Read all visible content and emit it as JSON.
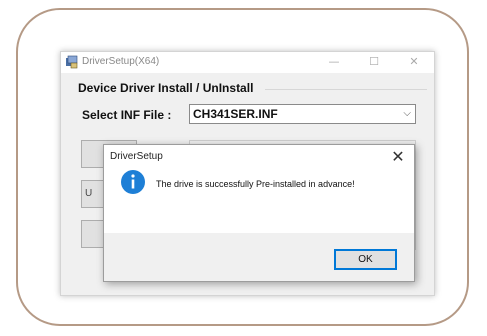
{
  "main_window": {
    "title": "DriverSetup(X64)",
    "minimize_glyph": "—",
    "maximize_glyph": "☐",
    "close_glyph": "✕",
    "group_label": "Device Driver Install / UnInstall",
    "inf_label": "Select INF File :",
    "inf_value": "CH341SER.INF",
    "combo_arrow": "⌵",
    "side_buttons": [
      {
        "label": ""
      },
      {
        "label": "U"
      },
      {
        "label": ""
      }
    ]
  },
  "dialog": {
    "title": "DriverSetup",
    "close_glyph": "✕",
    "message": "The drive is successfully Pre-installed in advance!",
    "icon": "info-icon",
    "ok_label": "OK"
  },
  "colors": {
    "frame_border": "#b59a86",
    "info_blue": "#1e7fd6",
    "ok_focus": "#0078d7"
  }
}
